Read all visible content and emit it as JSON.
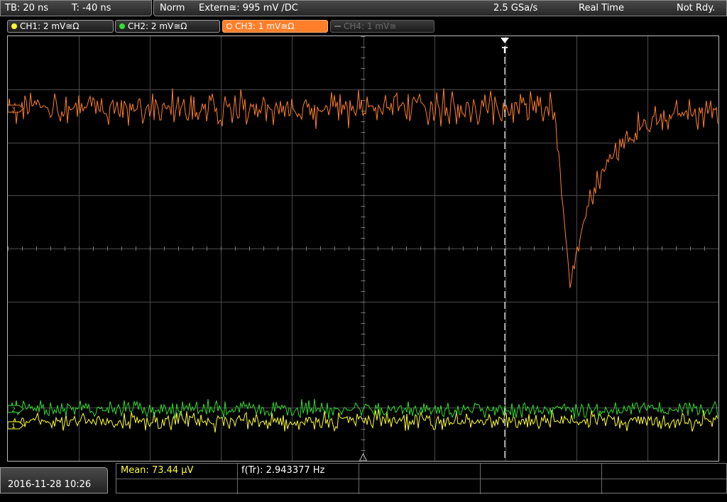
{
  "topbar": {
    "timebase": "TB: 20 ns",
    "trigger_time": "T: -40 ns",
    "trigger_mode": "Norm",
    "trigger_source": "Extern≅: 995 mV ∕DC",
    "sample_rate": "2.5 GSa/s",
    "acq_mode": "Real Time",
    "status": "Not Rdy."
  },
  "channels": [
    {
      "label": "CH1: 2 mV≅Ω",
      "color": "#ffff33",
      "active": true
    },
    {
      "label": "CH2: 2 mV≅Ω",
      "color": "#33dd33",
      "active": true
    },
    {
      "label": "CH3: 1 mV≅Ω",
      "color": "#ff7f2a",
      "active": true
    },
    {
      "label": "CH4: 1 mV≅",
      "color": "#6a6a6a",
      "active": false
    }
  ],
  "screen": {
    "trigger_marker": "T",
    "ch3_marker": "3",
    "ch2_marker": "2",
    "ch1_marker": "1"
  },
  "bottom": {
    "datetime": "2016-11-28 10:26",
    "mean": "Mean: 73.44 µV",
    "freq": "f(Tr): 2.943377 Hz"
  },
  "colors": {
    "ch1": "#ffff33",
    "ch2": "#33dd33",
    "ch3": "#ff7f2a",
    "grid": "#4a4a4a"
  }
}
